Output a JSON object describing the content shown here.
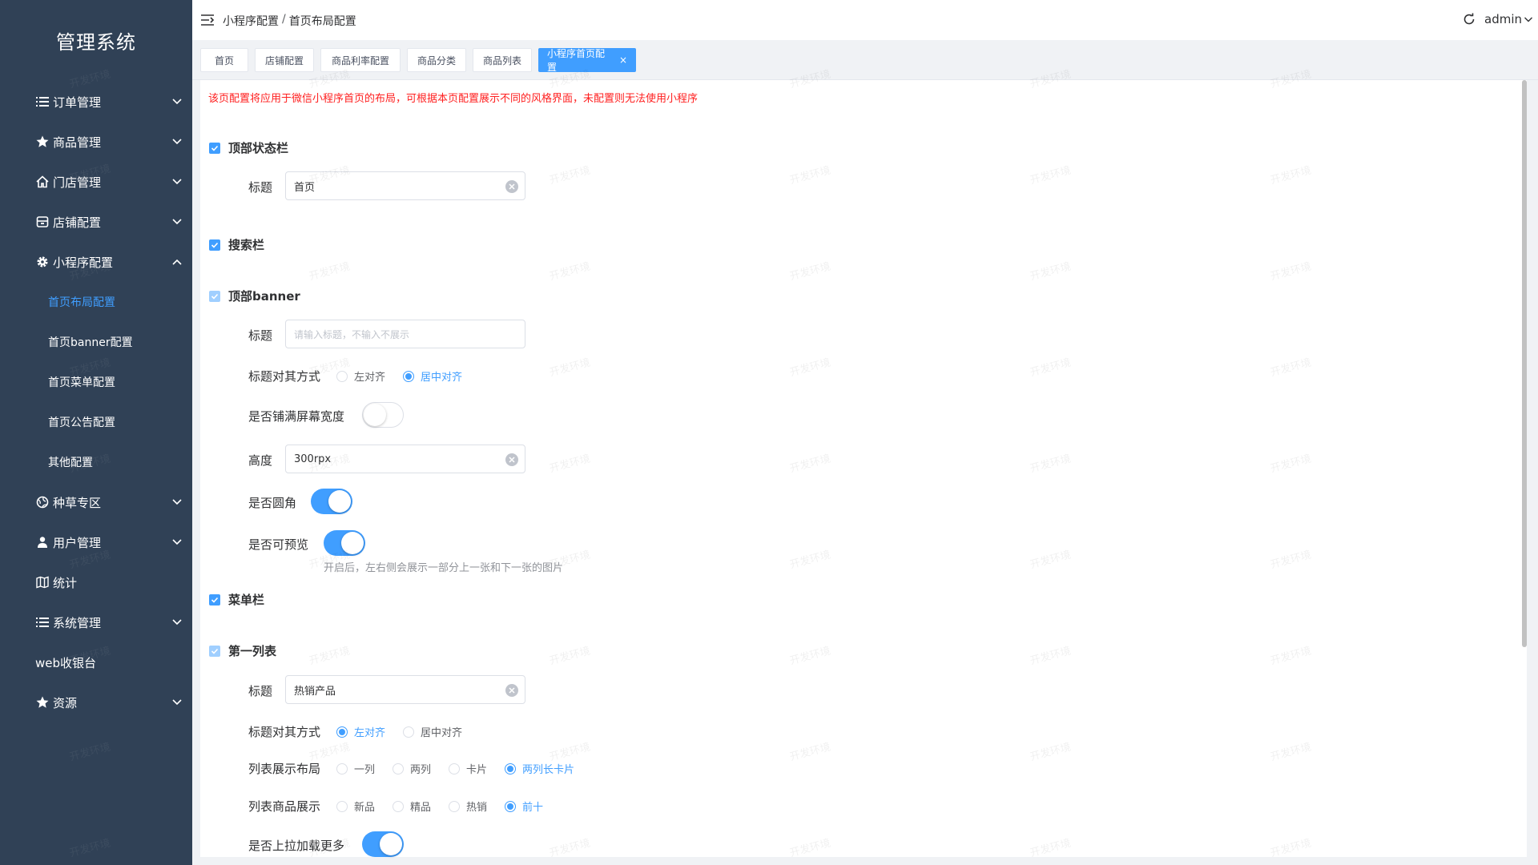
{
  "sidebar": {
    "logo": "管理系统",
    "items": [
      {
        "label": "订单管理",
        "icon": "list-icon"
      },
      {
        "label": "商品管理",
        "icon": "star-icon"
      },
      {
        "label": "门店管理",
        "icon": "home-icon"
      },
      {
        "label": "店铺配置",
        "icon": "store-icon"
      },
      {
        "label": "小程序配置",
        "icon": "gear-icon"
      },
      {
        "label": "种草专区",
        "icon": "globe-icon"
      },
      {
        "label": "用户管理",
        "icon": "user-icon"
      },
      {
        "label": "统计",
        "icon": "map-icon"
      },
      {
        "label": "系统管理",
        "icon": "list-icon"
      },
      {
        "label": "web收银台"
      },
      {
        "label": "资源",
        "icon": "star-icon"
      }
    ],
    "subitems": [
      "首页布局配置",
      "首页banner配置",
      "首页菜单配置",
      "首页公告配置",
      "其他配置"
    ]
  },
  "header": {
    "crumb1": "小程序配置",
    "separator": "/",
    "crumb2": "首页布局配置",
    "user": "admin"
  },
  "tags": [
    "首页",
    "店铺配置",
    "商品利率配置",
    "商品分类",
    "商品列表",
    "小程序首页配置"
  ],
  "tag_close": "×",
  "notice": "该页配置将应用于微信小程序首页的布局，可根据本页配置展示不同的风格界面，未配置则无法使用小程序",
  "form": {
    "top_status": {
      "label": "顶部状态栏",
      "title_label": "标题",
      "title_value": "首页"
    },
    "search": {
      "label": "搜索栏"
    },
    "banner": {
      "label": "顶部banner",
      "title_label": "标题",
      "title_placeholder": "请输入标题，不输入不展示",
      "align_label": "标题对其方式",
      "align_left": "左对齐",
      "align_center": "居中对齐",
      "fullwidth_label": "是否铺满屏幕宽度",
      "height_label": "高度",
      "height_value": "300rpx",
      "round_label": "是否圆角",
      "preview_label": "是否可预览",
      "preview_hint": "开启后，左右侧会展示一部分上一张和下一张的图片"
    },
    "menu": {
      "label": "菜单栏"
    },
    "list1": {
      "label": "第一列表",
      "title_label": "标题",
      "title_value": "热销产品",
      "align_label": "标题对其方式",
      "align_left": "左对齐",
      "align_center": "居中对齐",
      "layout_label": "列表展示布局",
      "layout_options": [
        "一列",
        "两列",
        "卡片",
        "两列长卡片"
      ],
      "goods_label": "列表商品展示",
      "goods_options": [
        "新品",
        "精品",
        "热销",
        "前十"
      ],
      "loadmore_label": "是否上拉加载更多"
    }
  },
  "watermark": "开发环境",
  "colors": {
    "sidebar_bg": "#304156",
    "primary": "#409eff",
    "notice": "#ff2020"
  }
}
